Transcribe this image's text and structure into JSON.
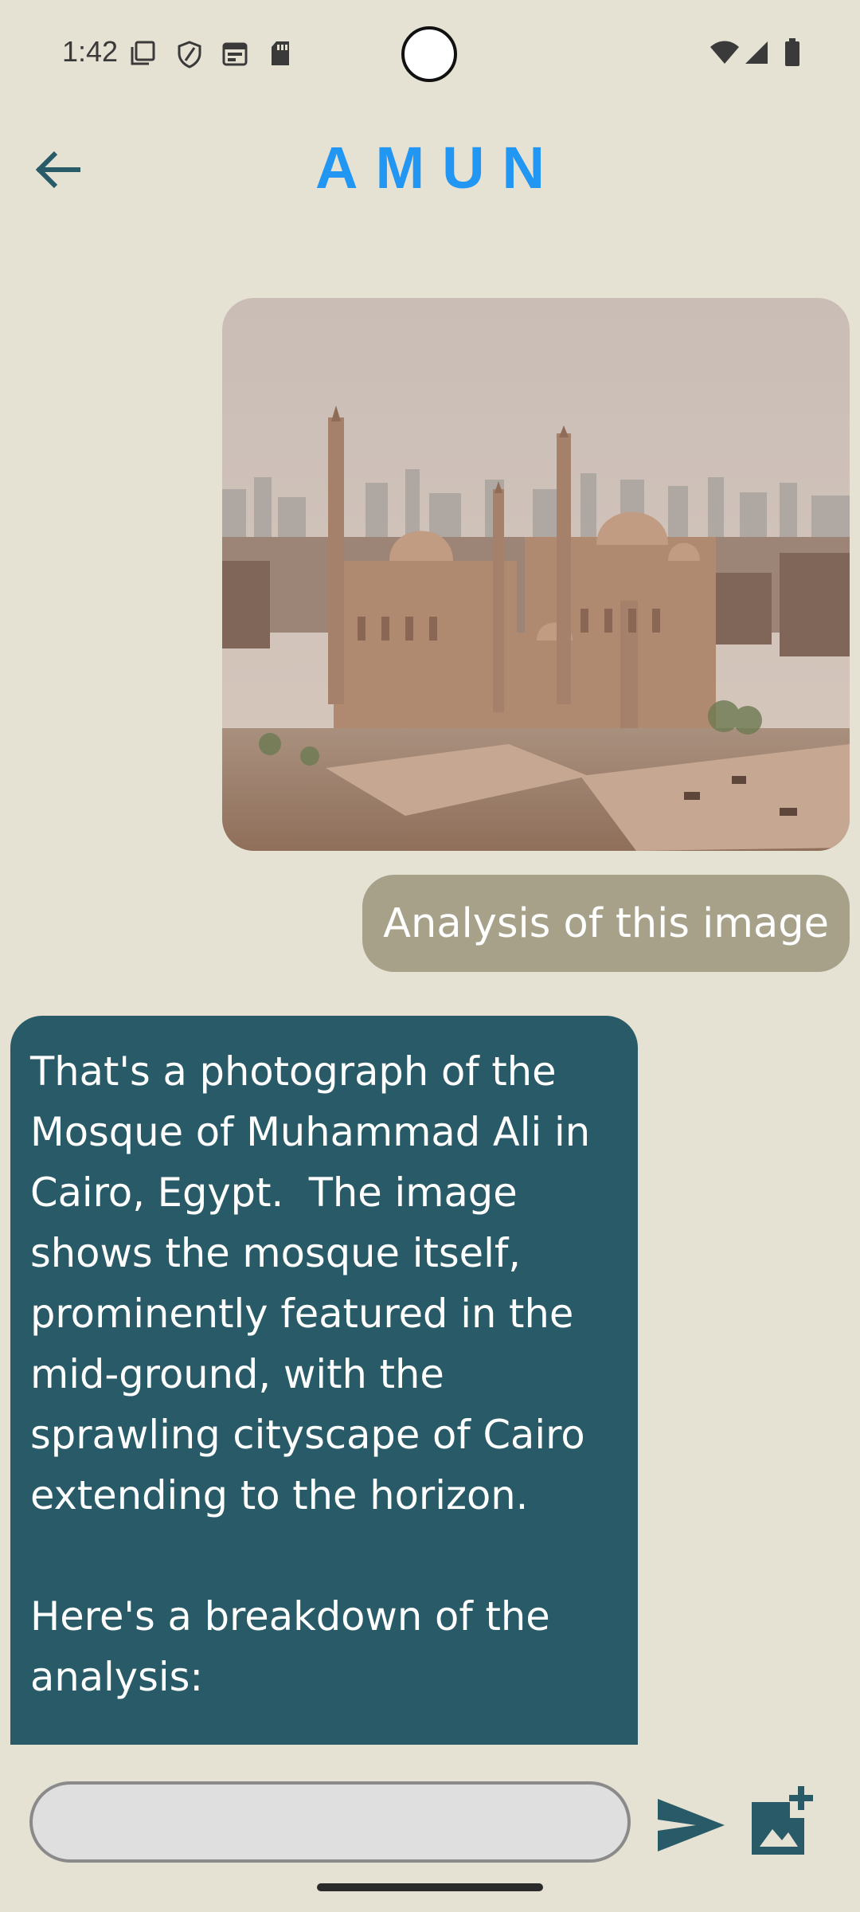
{
  "status_bar": {
    "time": "1:42",
    "icons": [
      "screen-record-icon",
      "shield-icon",
      "calendar-icon",
      "sd-card-icon"
    ],
    "right_icons": [
      "wifi-icon",
      "signal-icon",
      "battery-icon"
    ]
  },
  "header": {
    "title": "AMUN",
    "back_icon": "arrow-left-icon"
  },
  "chat": {
    "user_image_subject": "Cairo mosque photo",
    "user_message": "Analysis of this image",
    "bot_message": "That's a photograph of the\nMosque of Muhammad Ali in\nCairo, Egypt.  The image\nshows the mosque itself,\nprominently featured in the\nmid-ground, with the\nsprawling cityscape of Cairo\nextending to the horizon.\n\nHere's a breakdown of the\nanalysis:"
  },
  "input_bar": {
    "value": "",
    "placeholder": "",
    "send_icon": "send-icon",
    "add_image_icon": "add-photo-icon"
  },
  "colors": {
    "background": "#e5e2d4",
    "title": "#2196f3",
    "accent": "#285a67",
    "user_bubble": "#a8a18a"
  }
}
